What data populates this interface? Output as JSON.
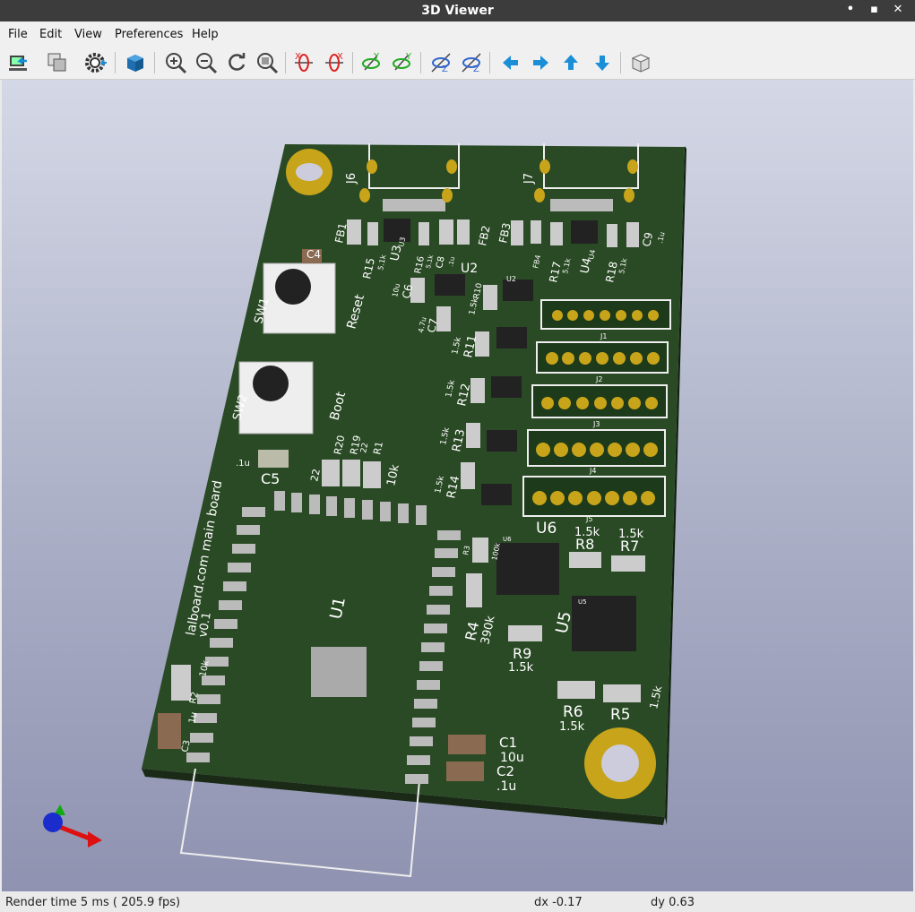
{
  "window": {
    "title": "3D Viewer",
    "controls": [
      "•",
      "▪",
      "✕"
    ]
  },
  "menu": [
    "File",
    "Edit",
    "View",
    "Preferences",
    "Help"
  ],
  "toolbar": {
    "icons": [
      "reload-board-icon",
      "copy-image-icon",
      "settings-icon",
      "render-mode-icon",
      "zoom-in-icon",
      "zoom-out-icon",
      "redraw-icon",
      "zoom-fit-icon",
      "rotate-x-cw-icon",
      "rotate-x-ccw-icon",
      "rotate-y-cw-icon",
      "rotate-y-ccw-icon",
      "rotate-z-cw-icon",
      "rotate-z-ccw-icon",
      "pan-left-icon",
      "pan-right-icon",
      "pan-up-icon",
      "pan-down-icon",
      "ortho-view-icon"
    ]
  },
  "board": {
    "silkscreen": {
      "connectors": [
        "J6",
        "J7",
        "J1",
        "J2",
        "J3",
        "J4",
        "J5"
      ],
      "switches": [
        "SW1",
        "Reset",
        "SW2",
        "Boot"
      ],
      "board_text": [
        "lalboard.com main board",
        "v0.1"
      ],
      "ic": [
        "U1",
        "U2",
        "U3",
        "U4",
        "U5",
        "U6"
      ],
      "labels": [
        {
          "t": "FB1"
        },
        {
          "t": "FB2"
        },
        {
          "t": "FB3"
        },
        {
          "t": "FB4"
        },
        {
          "t": "R15"
        },
        {
          "t": "5.1k"
        },
        {
          "t": "U3"
        },
        {
          "t": "R16"
        },
        {
          "t": "5.1k"
        },
        {
          "t": "C8"
        },
        {
          "t": ".1u"
        },
        {
          "t": "R17"
        },
        {
          "t": "5.1k"
        },
        {
          "t": "U4"
        },
        {
          "t": "R18"
        },
        {
          "t": "5.1k"
        },
        {
          "t": "C9"
        },
        {
          "t": ".1u"
        },
        {
          "t": "C4"
        },
        {
          "t": "C6"
        },
        {
          "t": "10u"
        },
        {
          "t": "C7"
        },
        {
          "t": "4.7u"
        },
        {
          "t": "U2"
        },
        {
          "t": "R10"
        },
        {
          "t": "1.5k"
        },
        {
          "t": "R11"
        },
        {
          "t": "1.5k"
        },
        {
          "t": "R12"
        },
        {
          "t": "1.5k"
        },
        {
          "t": "R13"
        },
        {
          "t": "1.5k"
        },
        {
          "t": "R14"
        },
        {
          "t": "1.5k"
        },
        {
          "t": "C5"
        },
        {
          "t": ".1u"
        },
        {
          "t": "R20"
        },
        {
          "t": "R19"
        },
        {
          "t": "22"
        },
        {
          "t": "22"
        },
        {
          "t": "R1"
        },
        {
          "t": "10k"
        },
        {
          "t": "U6"
        },
        {
          "t": "R8"
        },
        {
          "t": "1.5k"
        },
        {
          "t": "R7"
        },
        {
          "t": "1.5k"
        },
        {
          "t": "R3"
        },
        {
          "t": "100k"
        },
        {
          "t": "R4"
        },
        {
          "t": "390k"
        },
        {
          "t": "U5"
        },
        {
          "t": "R9"
        },
        {
          "t": "1.5k"
        },
        {
          "t": "R6"
        },
        {
          "t": "1.5k"
        },
        {
          "t": "R5"
        },
        {
          "t": "1.5k"
        },
        {
          "t": "R2"
        },
        {
          "t": "10k"
        },
        {
          "t": "C3"
        },
        {
          "t": "1u"
        },
        {
          "t": "C1"
        },
        {
          "t": "10u"
        },
        {
          "t": "C2"
        },
        {
          "t": ".1u"
        }
      ]
    }
  },
  "status": {
    "render": "Render time 5 ms ( 205.9 fps)",
    "dx": "dx -0.17",
    "dy": "dy 0.63"
  }
}
